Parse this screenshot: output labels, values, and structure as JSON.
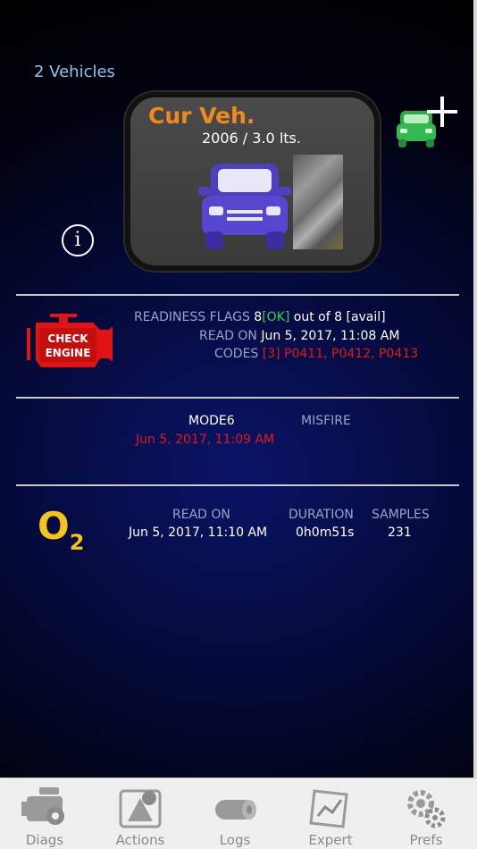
{
  "vehicles_link": "2 Vehicles",
  "current_vehicle": {
    "title": "Cur Veh.",
    "subtitle": "2006 / 3.0 lts."
  },
  "info_symbol": "i",
  "readiness": {
    "flags_label": "READINESS FLAGS",
    "flags_count": "8",
    "flags_ok": "[OK]",
    "flags_rest": "out of 8 [avail]",
    "read_on_label": "READ ON",
    "read_on_value": "Jun 5, 2017, 11:08 AM",
    "codes_label": "CODES",
    "codes_value": "[3] P0411, P0412, P0413",
    "check_engine_text_1": "CHECK",
    "check_engine_text_2": "ENGINE"
  },
  "mode6": {
    "mode6_label": "MODE6",
    "misfire_label": "MISFIRE",
    "date_value": "Jun 5, 2017, 11:09 AM"
  },
  "o2": {
    "symbol": "O",
    "subscript": "2",
    "read_on_label": "READ ON",
    "duration_label": "DURATION",
    "samples_label": "SAMPLES",
    "read_on_value": "Jun 5, 2017, 11:10 AM",
    "duration_value": "0h0m51s",
    "samples_value": "231"
  },
  "tabs": [
    {
      "label": "Diags",
      "icon": "engine-icon"
    },
    {
      "label": "Actions",
      "icon": "actions-icon"
    },
    {
      "label": "Logs",
      "icon": "logs-icon"
    },
    {
      "label": "Expert",
      "icon": "expert-icon"
    },
    {
      "label": "Prefs",
      "icon": "gears-icon"
    }
  ],
  "colors": {
    "accent_orange": "#f08a1c",
    "link_blue": "#8ec3f0",
    "ok_green": "#39d24a",
    "error_red": "#e01a1a",
    "o2_yellow": "#f5c41c"
  }
}
